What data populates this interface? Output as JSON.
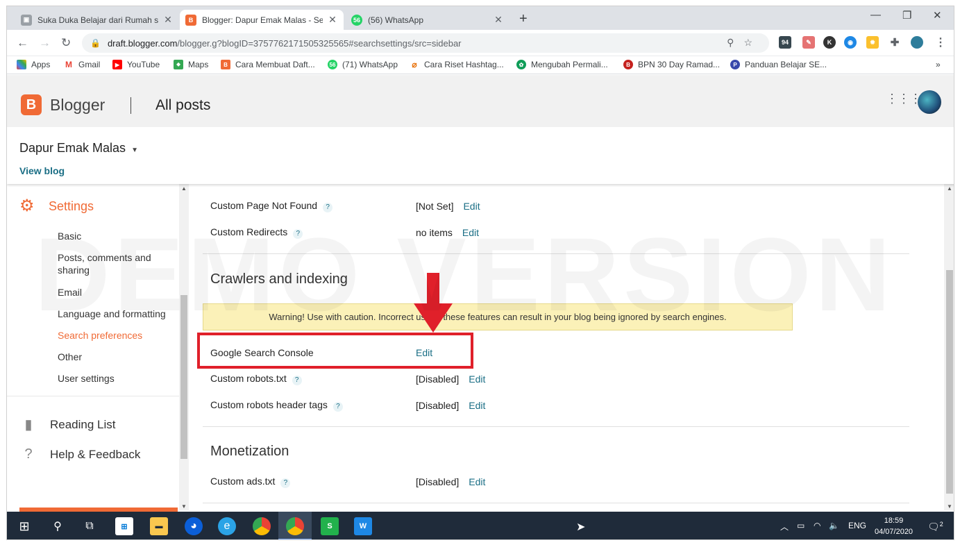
{
  "browser": {
    "tabs": [
      {
        "title": "Suka Duka Belajar dari Rumah sel",
        "active": false
      },
      {
        "title": "Blogger: Dapur Emak Malas - Sea",
        "active": true
      },
      {
        "title": "(56) WhatsApp",
        "active": false
      }
    ],
    "url_host": "draft.blogger.com",
    "url_path": "/blogger.g?blogID=3757762171505325565#searchsettings/src=sidebar",
    "extensions": [
      "94",
      "K"
    ],
    "bookmarks": [
      {
        "label": "Apps",
        "color": "#ea4335",
        "icon": "apps-grid-icon"
      },
      {
        "label": "Gmail",
        "color": "#ea4335",
        "icon": "gmail-icon"
      },
      {
        "label": "YouTube",
        "color": "#ff0000",
        "icon": "youtube-icon"
      },
      {
        "label": "Maps",
        "color": "#34a853",
        "icon": "maps-icon"
      },
      {
        "label": "Cara Membuat Daft...",
        "color": "#f06a35",
        "icon": "blogger-icon"
      },
      {
        "label": "(71) WhatsApp",
        "color": "#25d366",
        "icon": "whatsapp-icon"
      },
      {
        "label": "Cara Riset Hashtag...",
        "color": "#e8710a",
        "icon": "tag-icon"
      },
      {
        "label": "Mengubah Permali...",
        "color": "#0f9d58",
        "icon": "leaf-icon"
      },
      {
        "label": "BPN 30 Day Ramad...",
        "color": "#c5221f",
        "icon": "bpn-icon"
      },
      {
        "label": "Panduan Belajar SE...",
        "color": "#3949ab",
        "icon": "p-icon"
      }
    ],
    "bookmarks_more": "»"
  },
  "blogger": {
    "brand": "Blogger",
    "page_title": "All posts",
    "blog_name": "Dapur Emak Malas",
    "view_blog": "View blog"
  },
  "sidebar": {
    "settings_label": "Settings",
    "sub_items": [
      {
        "label": "Basic",
        "active": false
      },
      {
        "label": "Posts, comments and sharing",
        "active": false
      },
      {
        "label": "Email",
        "active": false
      },
      {
        "label": "Language and formatting",
        "active": false
      },
      {
        "label": "Search preferences",
        "active": true
      },
      {
        "label": "Other",
        "active": false
      },
      {
        "label": "User settings",
        "active": false
      }
    ],
    "reading_list": "Reading List",
    "help_feedback": "Help & Feedback"
  },
  "main": {
    "rows_top": [
      {
        "label": "Custom Page Not Found",
        "value": "[Not Set]",
        "edit": "Edit"
      },
      {
        "label": "Custom Redirects",
        "value": "no items",
        "edit": "Edit"
      }
    ],
    "crawlers_title": "Crawlers and indexing",
    "warning": "Warning! Use with caution. Incorrect use of these features can result in your blog being ignored by search engines.",
    "gsc": {
      "label": "Google Search Console",
      "edit": "Edit"
    },
    "rows_crawl": [
      {
        "label": "Custom robots.txt",
        "value": "[Disabled]",
        "edit": "Edit"
      },
      {
        "label": "Custom robots header tags",
        "value": "[Disabled]",
        "edit": "Edit"
      }
    ],
    "monetization_title": "Monetization",
    "rows_money": [
      {
        "label": "Custom ads.txt",
        "value": "[Disabled]",
        "edit": "Edit"
      }
    ],
    "help_mark": "?",
    "watermark": "DEMO VERSION"
  },
  "taskbar": {
    "language": "ENG",
    "time": "18:59",
    "date": "04/07/2020",
    "notifications": "2"
  },
  "colors": {
    "blogger_orange": "#f06a35",
    "link_teal": "#1a6e85",
    "highlight_red": "#e0202a",
    "warning_bg": "#fbf1b8"
  }
}
